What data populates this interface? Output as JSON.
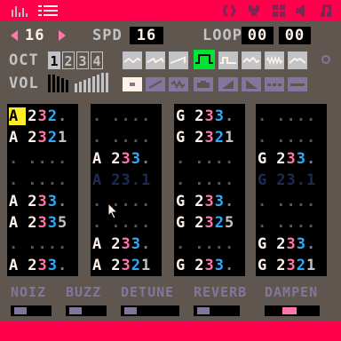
{
  "sfx": {
    "number": "16"
  },
  "speed": {
    "label": "SPD",
    "value": "16"
  },
  "loop": {
    "label": "LOOP",
    "start": "00",
    "end": "00"
  },
  "octave": {
    "label": "OCT",
    "options": [
      "1",
      "2",
      "3",
      "4"
    ],
    "selected": "1"
  },
  "volume": {
    "label": "VOL"
  },
  "waveforms": [
    "triangle",
    "tilted-saw",
    "saw",
    "square",
    "pulse",
    "organ",
    "noise",
    "phaser"
  ],
  "selected_waveform": "square",
  "effects": [
    "none",
    "slide",
    "vibrato",
    "drop",
    "fade-in",
    "fade-out",
    "arp-fast",
    "arp-slow"
  ],
  "selected_effect": "none",
  "channels": [
    {
      "lines": [
        {
          "note": "A",
          "oct": "2",
          "inst": "3",
          "vol": "2",
          "fx": ".",
          "cursor": true,
          "dim": false
        },
        {
          "note": "A",
          "oct": "2",
          "inst": "3",
          "vol": "2",
          "fx": "1",
          "cursor": false,
          "dim": false
        },
        {
          "note": ".",
          "oct": ".",
          "inst": ".",
          "vol": ".",
          "fx": ".",
          "cursor": false,
          "dim": true
        },
        {
          "note": ".",
          "oct": ".",
          "inst": ".",
          "vol": ".",
          "fx": ".",
          "cursor": false,
          "dim": true
        },
        {
          "note": "A",
          "oct": "2",
          "inst": "3",
          "vol": "3",
          "fx": ".",
          "cursor": false,
          "dim": false
        },
        {
          "note": "A",
          "oct": "2",
          "inst": "3",
          "vol": "3",
          "fx": "5",
          "cursor": false,
          "dim": false
        },
        {
          "note": ".",
          "oct": ".",
          "inst": ".",
          "vol": ".",
          "fx": ".",
          "cursor": false,
          "dim": true
        },
        {
          "note": "A",
          "oct": "2",
          "inst": "3",
          "vol": "3",
          "fx": ".",
          "cursor": false,
          "dim": false
        }
      ]
    },
    {
      "lines": [
        {
          "note": ".",
          "oct": ".",
          "inst": ".",
          "vol": ".",
          "fx": ".",
          "cursor": false,
          "dim": true
        },
        {
          "note": ".",
          "oct": ".",
          "inst": ".",
          "vol": ".",
          "fx": ".",
          "cursor": false,
          "dim": true
        },
        {
          "note": "A",
          "oct": "2",
          "inst": "3",
          "vol": "3",
          "fx": ".",
          "cursor": false,
          "dim": false
        },
        {
          "note": "A",
          "oct": "2",
          "inst": "3",
          "vol": ".",
          "fx": "1",
          "cursor": false,
          "dim": true,
          "faded": true
        },
        {
          "note": ".",
          "oct": ".",
          "inst": ".",
          "vol": ".",
          "fx": ".",
          "cursor": false,
          "dim": true
        },
        {
          "note": ".",
          "oct": ".",
          "inst": ".",
          "vol": ".",
          "fx": ".",
          "cursor": false,
          "dim": true
        },
        {
          "note": "A",
          "oct": "2",
          "inst": "3",
          "vol": "3",
          "fx": ".",
          "cursor": false,
          "dim": false
        },
        {
          "note": "A",
          "oct": "2",
          "inst": "3",
          "vol": "2",
          "fx": "1",
          "cursor": false,
          "dim": false
        }
      ]
    },
    {
      "lines": [
        {
          "note": "G",
          "oct": "2",
          "inst": "3",
          "vol": "3",
          "fx": ".",
          "cursor": false,
          "dim": false
        },
        {
          "note": "G",
          "oct": "2",
          "inst": "3",
          "vol": "2",
          "fx": "1",
          "cursor": false,
          "dim": false
        },
        {
          "note": ".",
          "oct": ".",
          "inst": ".",
          "vol": ".",
          "fx": ".",
          "cursor": false,
          "dim": true
        },
        {
          "note": ".",
          "oct": ".",
          "inst": ".",
          "vol": ".",
          "fx": ".",
          "cursor": false,
          "dim": true
        },
        {
          "note": "G",
          "oct": "2",
          "inst": "3",
          "vol": "3",
          "fx": ".",
          "cursor": false,
          "dim": false
        },
        {
          "note": "G",
          "oct": "2",
          "inst": "3",
          "vol": "2",
          "fx": "5",
          "cursor": false,
          "dim": false
        },
        {
          "note": ".",
          "oct": ".",
          "inst": ".",
          "vol": ".",
          "fx": ".",
          "cursor": false,
          "dim": true
        },
        {
          "note": "G",
          "oct": "2",
          "inst": "3",
          "vol": "3",
          "fx": ".",
          "cursor": false,
          "dim": false
        }
      ]
    },
    {
      "lines": [
        {
          "note": ".",
          "oct": ".",
          "inst": ".",
          "vol": ".",
          "fx": ".",
          "cursor": false,
          "dim": true
        },
        {
          "note": ".",
          "oct": ".",
          "inst": ".",
          "vol": ".",
          "fx": ".",
          "cursor": false,
          "dim": true
        },
        {
          "note": "G",
          "oct": "2",
          "inst": "3",
          "vol": "3",
          "fx": ".",
          "cursor": false,
          "dim": false
        },
        {
          "note": "G",
          "oct": "2",
          "inst": "3",
          "vol": ".",
          "fx": "1",
          "cursor": false,
          "dim": true,
          "faded": true
        },
        {
          "note": ".",
          "oct": ".",
          "inst": ".",
          "vol": ".",
          "fx": ".",
          "cursor": false,
          "dim": true
        },
        {
          "note": ".",
          "oct": ".",
          "inst": ".",
          "vol": ".",
          "fx": ".",
          "cursor": false,
          "dim": true
        },
        {
          "note": "G",
          "oct": "2",
          "inst": "3",
          "vol": "3",
          "fx": ".",
          "cursor": false,
          "dim": false
        },
        {
          "note": "G",
          "oct": "2",
          "inst": "3",
          "vol": "2",
          "fx": "1",
          "cursor": false,
          "dim": false
        }
      ]
    }
  ],
  "fx_labels": [
    {
      "label": "NOIZ",
      "on": false
    },
    {
      "label": "BUZZ",
      "on": false
    },
    {
      "label": "DETUNE",
      "on": false
    },
    {
      "label": "REVERB",
      "on": false
    },
    {
      "label": "DAMPEN",
      "on": true
    }
  ],
  "colors": {
    "accent": "#ff004d",
    "panel": "#5f574f",
    "light": "#c2c3c7",
    "white": "#fff1e8",
    "pink": "#ff77a8",
    "blue": "#29adff",
    "lavender": "#83769c",
    "yellow": "#ffec27",
    "green": "#00e436",
    "dark": "#1d2b53"
  }
}
